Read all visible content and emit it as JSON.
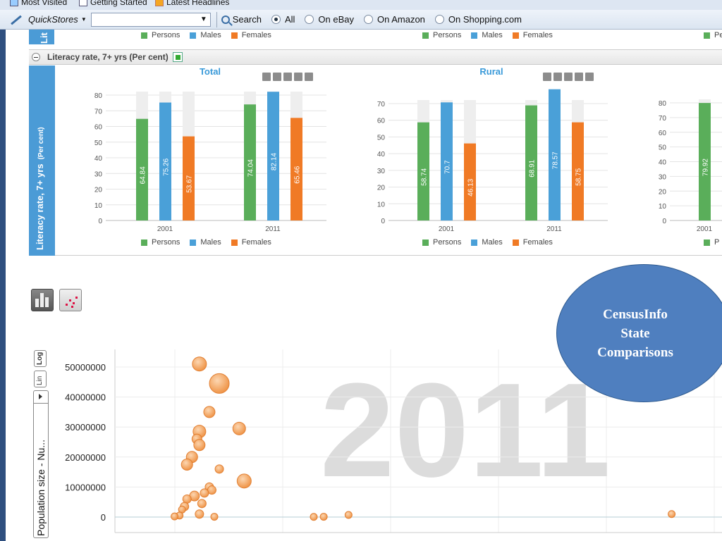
{
  "browser": {
    "bookmarks": {
      "most_visited": "Most Visited",
      "getting_started": "Getting Started",
      "latest_headlines": "Latest Headlines"
    },
    "quickstores": {
      "label": "QuickStores",
      "search_label": "Search",
      "radio_options": [
        "All",
        "On eBay",
        "On Amazon",
        "On Shopping.com"
      ],
      "selected": "All"
    }
  },
  "literacy_panel": {
    "top_strip_text": "Lit",
    "legend": [
      "Persons",
      "Males",
      "Females"
    ],
    "header_title": "Literacy rate, 7+ yrs (Per cent)",
    "side_title": "Literacy rate, 7+ yrs",
    "side_unit": "(Per cent)",
    "colors": {
      "persons": "#5aae5a",
      "males": "#4aa0d8",
      "females": "#f07a25",
      "remainder": "#eeeeee"
    }
  },
  "callout": {
    "lines": [
      "CensusInfo",
      "State",
      "Comparisons"
    ],
    "fill_color": "#4f7fbf"
  },
  "bubble_chart": {
    "scale_log_label": "Log",
    "scale_lin_label": "Lin",
    "y_axis_selector": "Population size - Nu...",
    "watermark_year": "2011",
    "bubble_color": "#f4a460"
  },
  "chart_data": [
    {
      "type": "bar",
      "title": "Total",
      "categories": [
        "2001",
        "2011"
      ],
      "ylim": [
        0,
        80
      ],
      "yticks": [
        0,
        10,
        20,
        30,
        40,
        50,
        60,
        70,
        80
      ],
      "series": [
        {
          "name": "Persons",
          "values": [
            64.84,
            74.04
          ]
        },
        {
          "name": "Males",
          "values": [
            75.26,
            82.14
          ]
        },
        {
          "name": "Females",
          "values": [
            53.67,
            65.46
          ]
        }
      ]
    },
    {
      "type": "bar",
      "title": "Rural",
      "categories": [
        "2001",
        "2011"
      ],
      "ylim": [
        0,
        70
      ],
      "yticks": [
        0,
        10,
        20,
        30,
        40,
        50,
        60,
        70
      ],
      "series": [
        {
          "name": "Persons",
          "values": [
            58.74,
            68.91
          ]
        },
        {
          "name": "Males",
          "values": [
            70.7,
            78.57
          ]
        },
        {
          "name": "Females",
          "values": [
            46.13,
            58.75
          ]
        }
      ]
    },
    {
      "type": "bar",
      "title": "",
      "categories": [
        "2001"
      ],
      "ylim": [
        0,
        80
      ],
      "yticks": [
        0,
        10,
        20,
        30,
        40,
        50,
        60,
        70,
        80
      ],
      "series": [
        {
          "name": "Persons",
          "values": [
            79.92
          ]
        }
      ]
    },
    {
      "type": "scatter",
      "ylabel": "Population size - Nu...",
      "yticks": [
        0,
        10000000,
        20000000,
        30000000,
        40000000,
        50000000
      ],
      "ylim": [
        0,
        50000000
      ],
      "points": [
        {
          "x": 17,
          "y": 51000000,
          "r": 10
        },
        {
          "x": 21,
          "y": 44500000,
          "r": 14
        },
        {
          "x": 19,
          "y": 35000000,
          "r": 8
        },
        {
          "x": 25,
          "y": 29500000,
          "r": 9
        },
        {
          "x": 17,
          "y": 28500000,
          "r": 9
        },
        {
          "x": 16.5,
          "y": 26000000,
          "r": 7
        },
        {
          "x": 17,
          "y": 24000000,
          "r": 8
        },
        {
          "x": 15.5,
          "y": 20000000,
          "r": 8
        },
        {
          "x": 14.5,
          "y": 17500000,
          "r": 8
        },
        {
          "x": 21,
          "y": 16000000,
          "r": 6
        },
        {
          "x": 26,
          "y": 12000000,
          "r": 10
        },
        {
          "x": 19,
          "y": 10000000,
          "r": 6
        },
        {
          "x": 19.5,
          "y": 9000000,
          "r": 6
        },
        {
          "x": 18,
          "y": 8000000,
          "r": 6
        },
        {
          "x": 16,
          "y": 7000000,
          "r": 7
        },
        {
          "x": 14.5,
          "y": 6000000,
          "r": 6
        },
        {
          "x": 17.5,
          "y": 4500000,
          "r": 6
        },
        {
          "x": 14,
          "y": 3500000,
          "r": 6
        },
        {
          "x": 13.5,
          "y": 2500000,
          "r": 5
        },
        {
          "x": 17,
          "y": 1000000,
          "r": 6
        },
        {
          "x": 13,
          "y": 500000,
          "r": 5
        },
        {
          "x": 12,
          "y": 200000,
          "r": 5
        },
        {
          "x": 20,
          "y": 100000,
          "r": 5
        },
        {
          "x": 40,
          "y": 50000,
          "r": 5
        },
        {
          "x": 42,
          "y": 100000,
          "r": 5
        },
        {
          "x": 47,
          "y": 700000,
          "r": 5
        },
        {
          "x": 112,
          "y": 1000000,
          "r": 5
        }
      ]
    }
  ]
}
